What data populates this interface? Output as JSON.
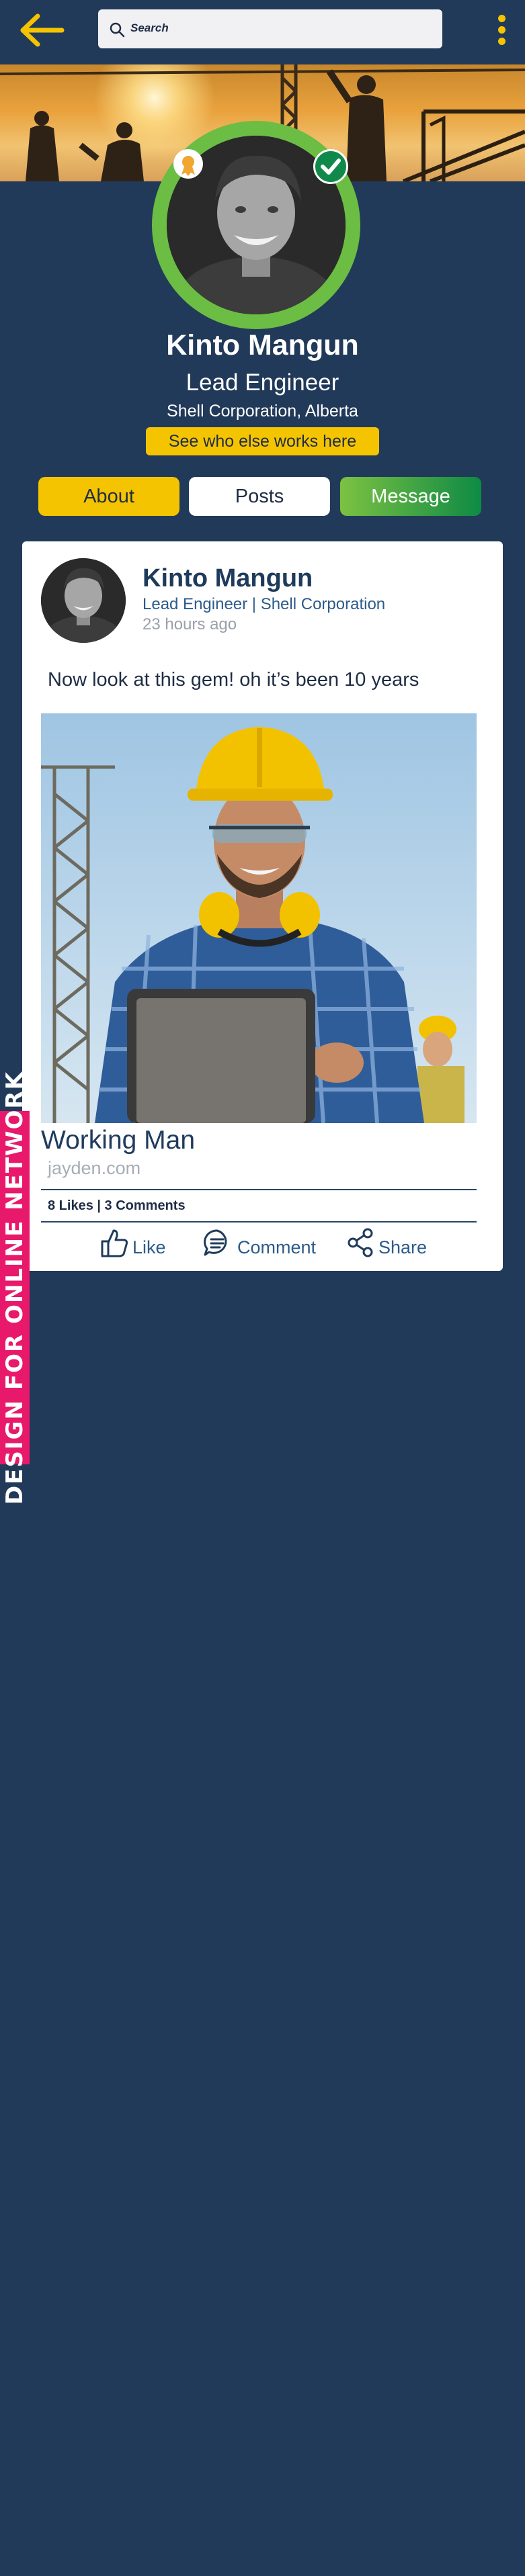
{
  "header": {
    "search_placeholder": "Search"
  },
  "profile": {
    "name": "Kinto Mangun",
    "role": "Lead Engineer",
    "location": "Shell Corporation, Alberta",
    "coworkers_button": "See who else works here"
  },
  "tabs": {
    "about": "About",
    "posts": "Posts",
    "message": "Message"
  },
  "post": {
    "author": "Kinto Mangun",
    "subtitle": "Lead Engineer | Shell Corporation",
    "time": "23 hours ago",
    "text": "Now look at this gem! oh it’s been 10 years",
    "link_title": "Working Man",
    "link_domain": "jayden.com",
    "stats": "8 Likes | 3 Comments",
    "actions": {
      "like": "Like",
      "comment": "Comment",
      "share": "Share"
    }
  },
  "ribbon": {
    "text": "DESIGN FOR ONLINE NETWORK"
  },
  "colors": {
    "background": "#223a59",
    "accent_yellow": "#f5c400",
    "accent_green": "#6bbd44",
    "ribbon_pink": "#e8196a",
    "text_blue": "#2d5b8a"
  }
}
